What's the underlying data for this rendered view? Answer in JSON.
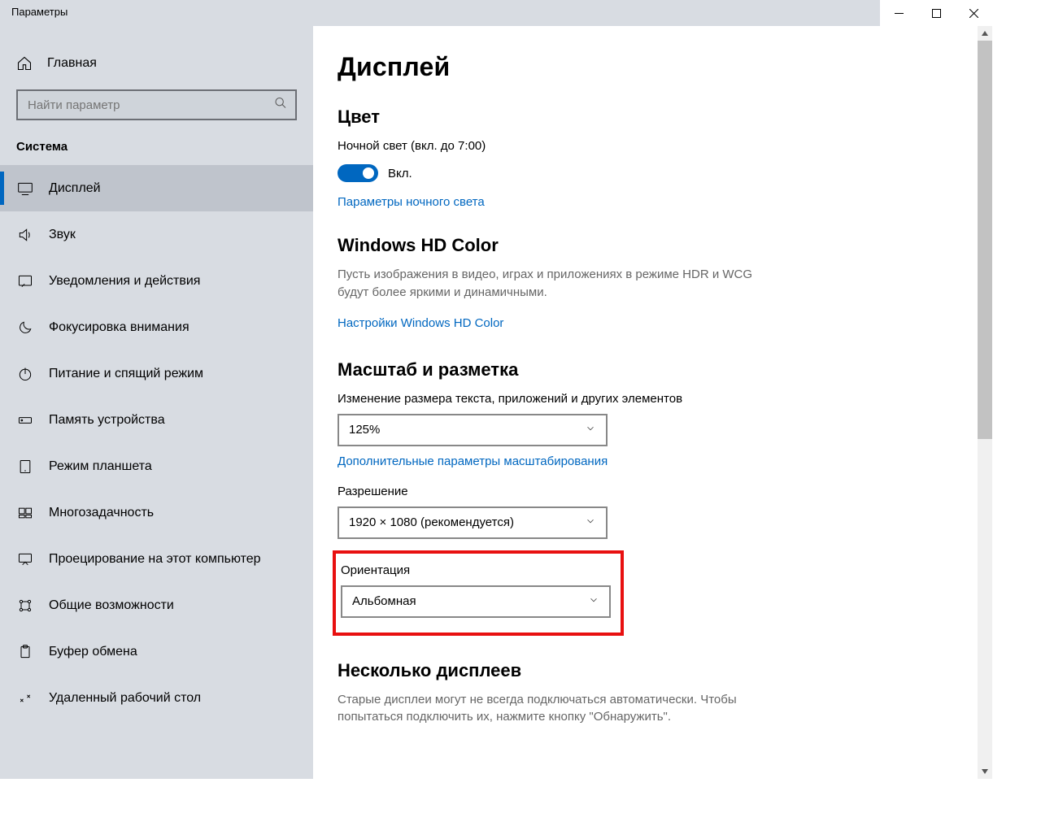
{
  "window": {
    "title": "Параметры"
  },
  "sidebar": {
    "home": "Главная",
    "search_placeholder": "Найти параметр",
    "category": "Система",
    "items": [
      {
        "label": "Дисплей"
      },
      {
        "label": "Звук"
      },
      {
        "label": "Уведомления и действия"
      },
      {
        "label": "Фокусировка внимания"
      },
      {
        "label": "Питание и спящий режим"
      },
      {
        "label": "Память устройства"
      },
      {
        "label": "Режим планшета"
      },
      {
        "label": "Многозадачность"
      },
      {
        "label": "Проецирование на этот компьютер"
      },
      {
        "label": "Общие возможности"
      },
      {
        "label": "Буфер обмена"
      },
      {
        "label": "Удаленный рабочий стол"
      }
    ]
  },
  "main": {
    "title": "Дисплей",
    "color_heading": "Цвет",
    "night_light_label": "Ночной свет (вкл. до 7:00)",
    "toggle_state": "Вкл.",
    "night_light_link": "Параметры ночного света",
    "hdcolor_heading": "Windows HD Color",
    "hdcolor_desc": "Пусть изображения в видео, играх и приложениях в режиме HDR и WCG будут более яркими и динамичными.",
    "hdcolor_link": "Настройки Windows HD Color",
    "scale_heading": "Масштаб и разметка",
    "scale_label": "Изменение размера текста, приложений и других элементов",
    "scale_value": "125%",
    "scale_link": "Дополнительные параметры масштабирования",
    "resolution_label": "Разрешение",
    "resolution_value": "1920 × 1080 (рекомендуется)",
    "orientation_label": "Ориентация",
    "orientation_value": "Альбомная",
    "multi_heading": "Несколько дисплеев",
    "multi_desc": "Старые дисплеи могут не всегда подключаться автоматически. Чтобы попытаться подключить их, нажмите кнопку \"Обнаружить\"."
  }
}
